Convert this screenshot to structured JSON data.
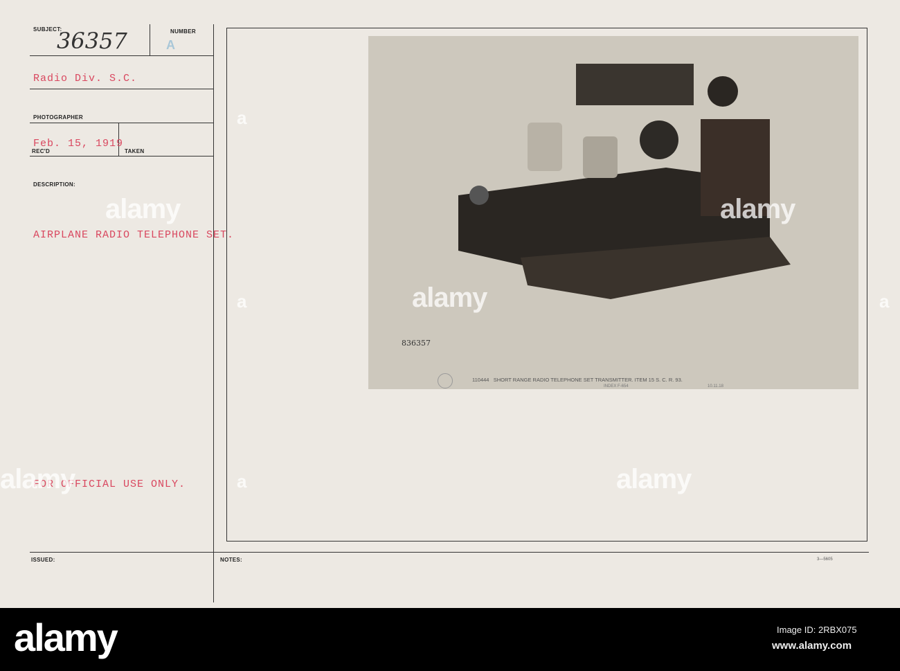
{
  "card": {
    "subject_label": "SUBJECT:",
    "subject_number": "36357",
    "number_label": "NUMBER",
    "number_value": "A",
    "division": "Radio Div. S.C.",
    "photographer_label": "PHOTOGRAPHER",
    "recd_label": "REC'D",
    "recd_date": "Feb. 15, 1919",
    "taken_label": "TAKEN",
    "description_label": "DESCRIPTION:",
    "description": "AIRPLANE RADIO TELEPHONE SET.",
    "restriction": "FOR OFFICIAL USE ONLY.",
    "issued_label": "ISSUED:",
    "notes_label": "NOTES:",
    "form_number": "3—5605"
  },
  "photo": {
    "handwritten_number": "836357",
    "caption": "110444   SHORT RANGE RADIO TELEPHONE SET TRANSMITTER. ITEM 15 S. C. R. 93.",
    "caption_sub": "INDEX F-654",
    "caption_date": "10.11.18"
  },
  "watermark": {
    "text": "alamy",
    "letter": "a",
    "image_id": "Image ID: 2RBX075",
    "url": "www.alamy.com"
  }
}
